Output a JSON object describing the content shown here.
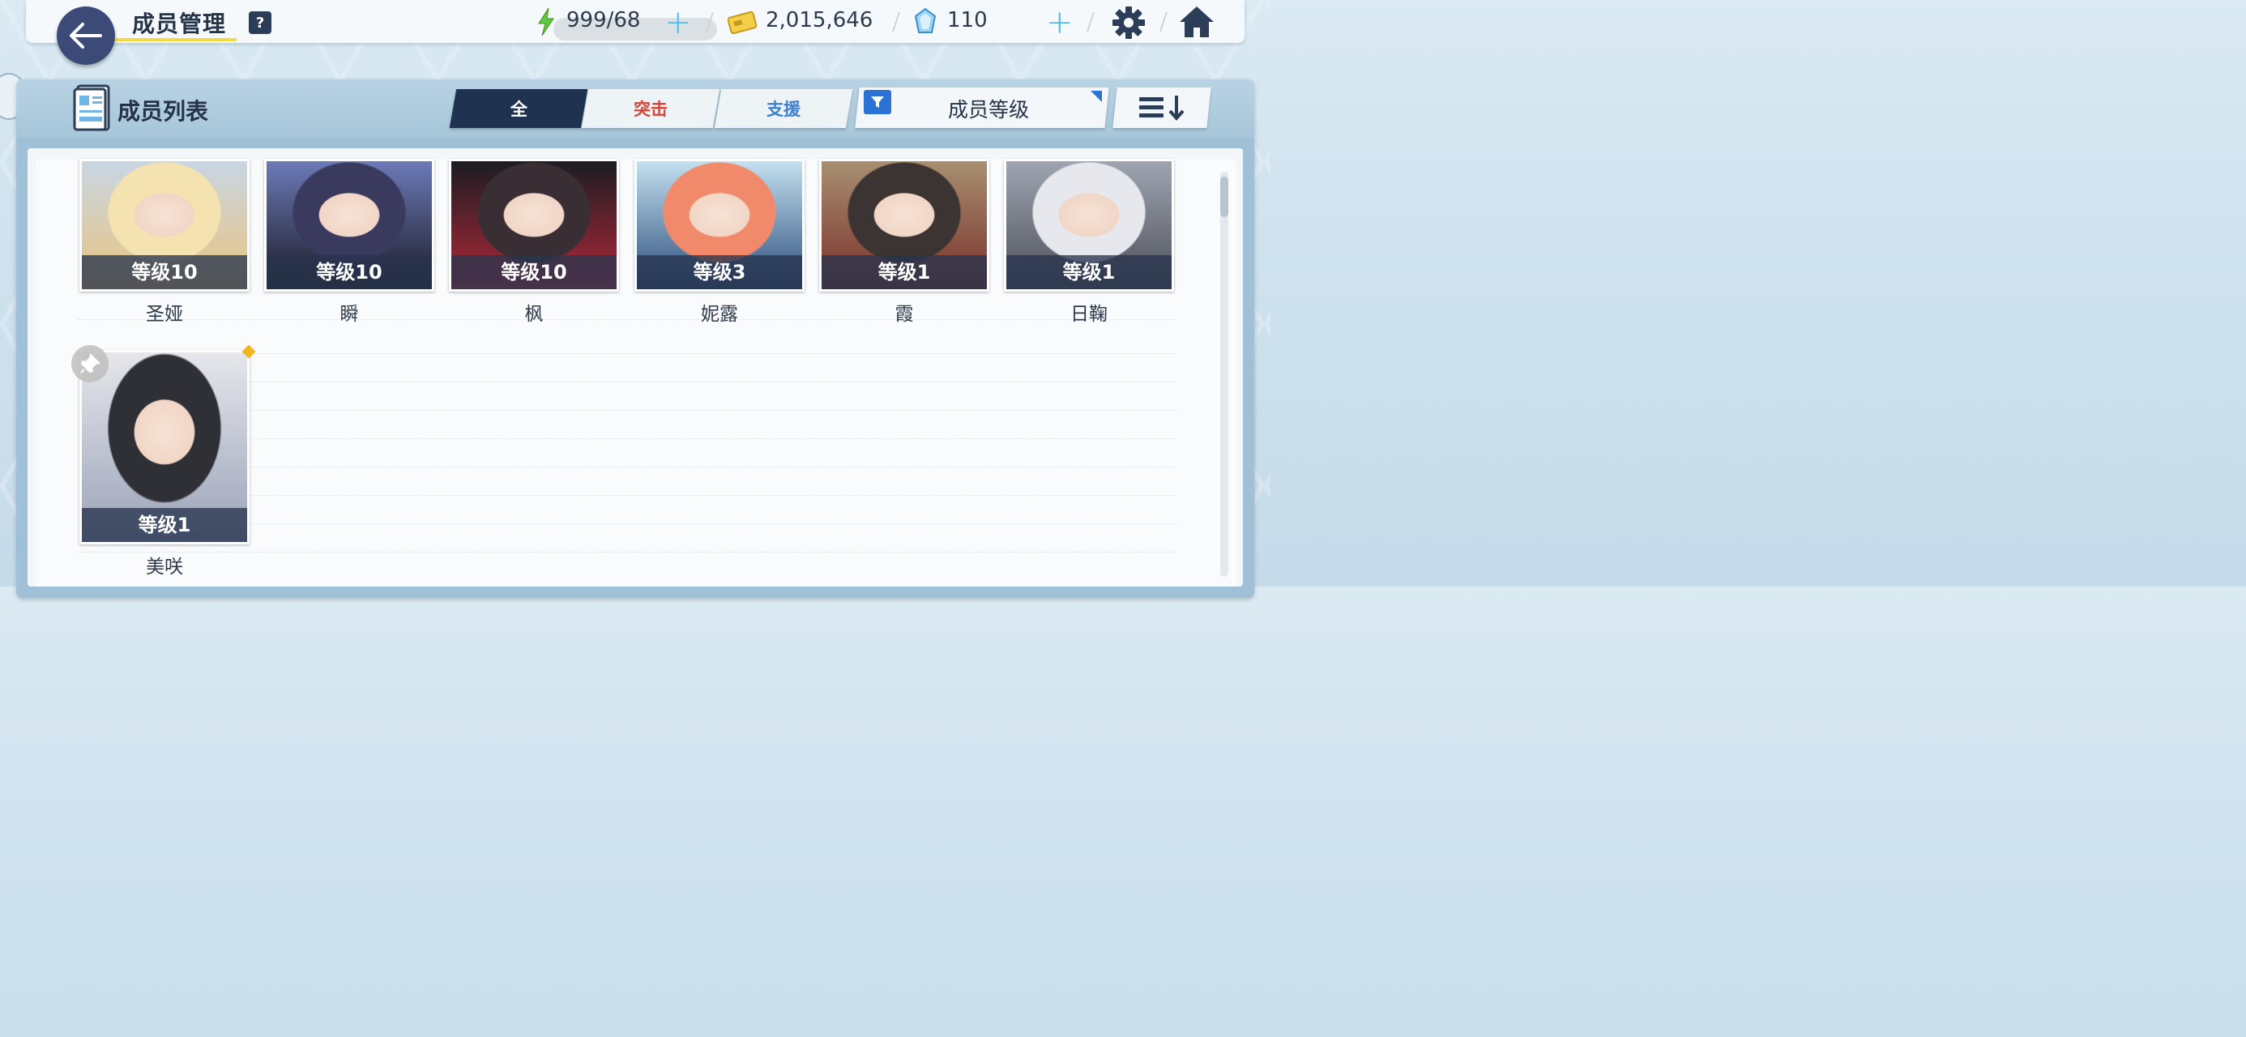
{
  "header": {
    "title": "成员管理",
    "help": "?",
    "ap": "999/68",
    "credits": "2,015,646",
    "gems": "110",
    "plus": "+"
  },
  "list": {
    "title": "成员列表",
    "tabs": [
      {
        "label": "全"
      },
      {
        "label": "突击"
      },
      {
        "label": "支援"
      }
    ],
    "filter_label": "成员等级"
  },
  "members": [
    {
      "name": "圣娅",
      "level": "等级10",
      "colors": [
        "#f4e2b0",
        "#e9c37d",
        "#c9d6e4"
      ]
    },
    {
      "name": "瞬",
      "level": "等级10",
      "colors": [
        "#3a3a5e",
        "#1a1a24",
        "#6c7ab8"
      ]
    },
    {
      "name": "枫",
      "level": "等级10",
      "colors": [
        "#3a2e35",
        "#b3293a",
        "#1c1c22"
      ]
    },
    {
      "name": "妮露",
      "level": "等级3",
      "colors": [
        "#f08a6a",
        "#2a4b7a",
        "#c3e1f0"
      ]
    },
    {
      "name": "霞",
      "level": "等级1",
      "colors": [
        "#3c3432",
        "#7a2f2a",
        "#a88f70"
      ]
    },
    {
      "name": "日鞠",
      "level": "等级1",
      "colors": [
        "#e7e8ee",
        "#4c4e57",
        "#9ea5b1"
      ]
    },
    {
      "name": "美咲",
      "level": "等级1",
      "colors": [
        "#2f3036",
        "#9aa2b8",
        "#e6e7ec"
      ]
    }
  ],
  "colors": {
    "accent": "#1f3350",
    "strike": "#d3463c",
    "support": "#3f7fd1",
    "filter": "#2a73d4"
  }
}
